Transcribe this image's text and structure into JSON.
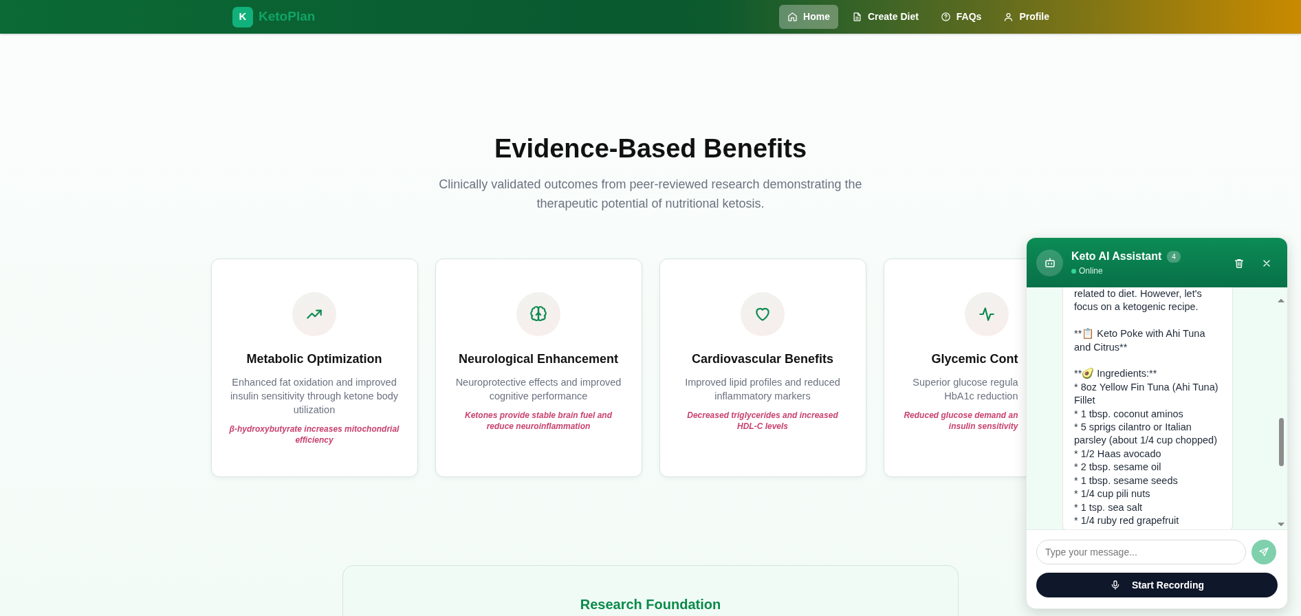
{
  "navbar": {
    "logo_letter": "K",
    "brand": "KetoPlan",
    "links": [
      {
        "label": "Home",
        "selected": true
      },
      {
        "label": "Create Diet",
        "selected": false
      },
      {
        "label": "FAQs",
        "selected": false
      },
      {
        "label": "Profile",
        "selected": false
      }
    ]
  },
  "section": {
    "title": "Evidence-Based Benefits",
    "subtitle": "Clinically validated outcomes from peer-reviewed research demonstrating the therapeutic potential of nutritional ketosis."
  },
  "benefits": [
    {
      "title": "Metabolic Optimization",
      "description": "Enhanced fat oxidation and improved insulin sensitivity through ketone body utilization",
      "evidence": "β-hydroxybutyrate increases mitochondrial efficiency"
    },
    {
      "title": "Neurological Enhancement",
      "description": "Neuroprotective effects and improved cognitive performance",
      "evidence": "Ketones provide stable brain fuel and reduce neuroinflammation"
    },
    {
      "title": "Cardiovascular Benefits",
      "description": "Improved lipid profiles and reduced inflammatory markers",
      "evidence": "Decreased triglycerides and increased HDL-C levels"
    },
    {
      "title": "Glycemic Cont",
      "description": "Superior glucose regula\nHbA1c reduction",
      "evidence": "Reduced glucose demand an\ninsulin sensitivity"
    }
  ],
  "research": {
    "title": "Research Foundation"
  },
  "chat": {
    "title": "Keto AI Assistant",
    "badge": "4",
    "status": "Online",
    "online": true,
    "message": "related to diet. However, let's focus on a ketogenic recipe.\n\n**📋 Keto Poke with Ahi Tuna and Citrus**\n\n**🥑 Ingredients:**\n* 8oz Yellow Fin Tuna (Ahi Tuna) Fillet\n* 1 tbsp. coconut aminos\n* 5 sprigs cilantro or Italian parsley (about 1/4 cup chopped)\n* 1/2 Haas avocado\n* 2 tbsp. sesame oil\n* 1 tbsp. sesame seeds\n* 1/4 cup pili nuts\n* 1 tsp. sea salt\n* 1/4 ruby red grapefruit",
    "input": {
      "placeholder": "Type your message..."
    },
    "record_button": "Start Recording"
  }
}
